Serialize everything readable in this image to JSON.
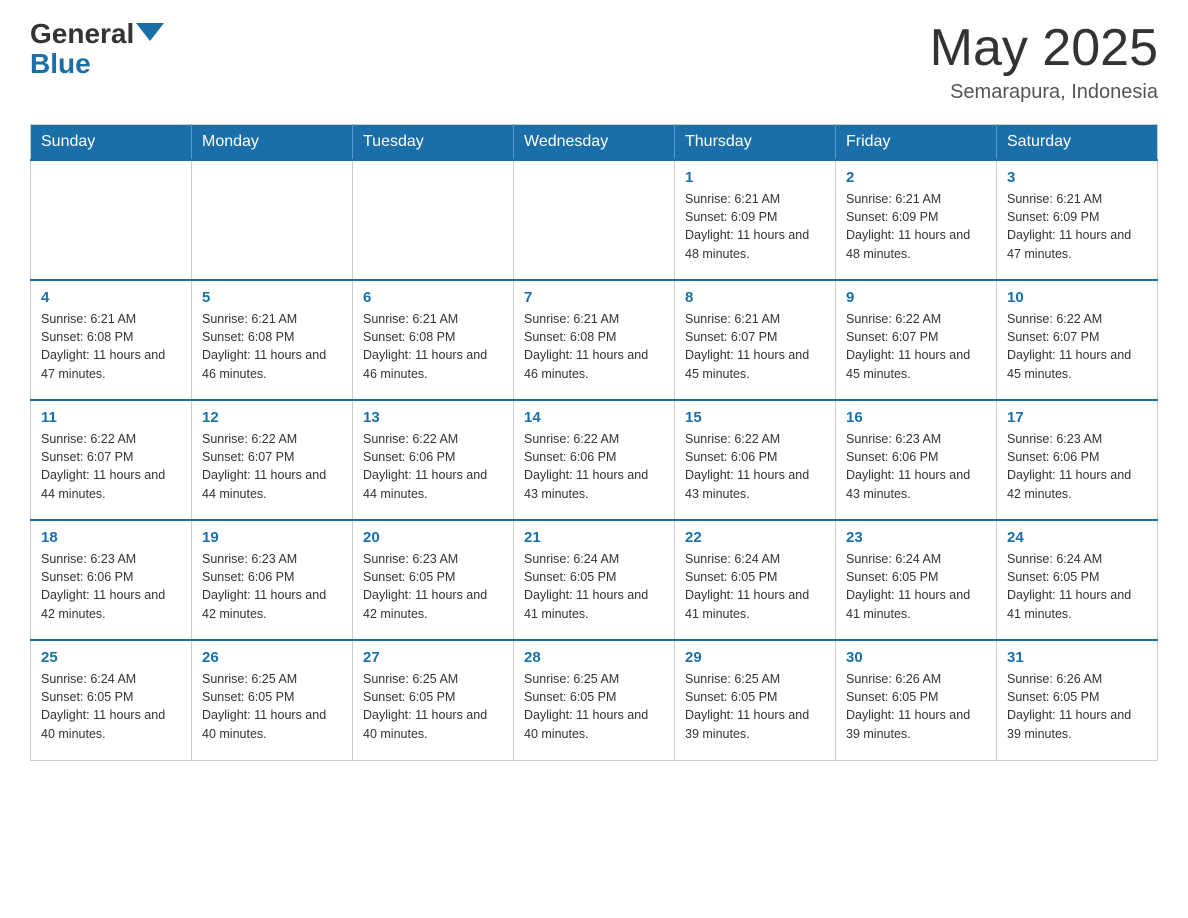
{
  "header": {
    "logo_text": "General",
    "logo_blue": "Blue",
    "month_title": "May 2025",
    "location": "Semarapura, Indonesia"
  },
  "weekdays": [
    "Sunday",
    "Monday",
    "Tuesday",
    "Wednesday",
    "Thursday",
    "Friday",
    "Saturday"
  ],
  "weeks": [
    [
      {
        "day": "",
        "info": ""
      },
      {
        "day": "",
        "info": ""
      },
      {
        "day": "",
        "info": ""
      },
      {
        "day": "",
        "info": ""
      },
      {
        "day": "1",
        "info": "Sunrise: 6:21 AM\nSunset: 6:09 PM\nDaylight: 11 hours and 48 minutes."
      },
      {
        "day": "2",
        "info": "Sunrise: 6:21 AM\nSunset: 6:09 PM\nDaylight: 11 hours and 48 minutes."
      },
      {
        "day": "3",
        "info": "Sunrise: 6:21 AM\nSunset: 6:09 PM\nDaylight: 11 hours and 47 minutes."
      }
    ],
    [
      {
        "day": "4",
        "info": "Sunrise: 6:21 AM\nSunset: 6:08 PM\nDaylight: 11 hours and 47 minutes."
      },
      {
        "day": "5",
        "info": "Sunrise: 6:21 AM\nSunset: 6:08 PM\nDaylight: 11 hours and 46 minutes."
      },
      {
        "day": "6",
        "info": "Sunrise: 6:21 AM\nSunset: 6:08 PM\nDaylight: 11 hours and 46 minutes."
      },
      {
        "day": "7",
        "info": "Sunrise: 6:21 AM\nSunset: 6:08 PM\nDaylight: 11 hours and 46 minutes."
      },
      {
        "day": "8",
        "info": "Sunrise: 6:21 AM\nSunset: 6:07 PM\nDaylight: 11 hours and 45 minutes."
      },
      {
        "day": "9",
        "info": "Sunrise: 6:22 AM\nSunset: 6:07 PM\nDaylight: 11 hours and 45 minutes."
      },
      {
        "day": "10",
        "info": "Sunrise: 6:22 AM\nSunset: 6:07 PM\nDaylight: 11 hours and 45 minutes."
      }
    ],
    [
      {
        "day": "11",
        "info": "Sunrise: 6:22 AM\nSunset: 6:07 PM\nDaylight: 11 hours and 44 minutes."
      },
      {
        "day": "12",
        "info": "Sunrise: 6:22 AM\nSunset: 6:07 PM\nDaylight: 11 hours and 44 minutes."
      },
      {
        "day": "13",
        "info": "Sunrise: 6:22 AM\nSunset: 6:06 PM\nDaylight: 11 hours and 44 minutes."
      },
      {
        "day": "14",
        "info": "Sunrise: 6:22 AM\nSunset: 6:06 PM\nDaylight: 11 hours and 43 minutes."
      },
      {
        "day": "15",
        "info": "Sunrise: 6:22 AM\nSunset: 6:06 PM\nDaylight: 11 hours and 43 minutes."
      },
      {
        "day": "16",
        "info": "Sunrise: 6:23 AM\nSunset: 6:06 PM\nDaylight: 11 hours and 43 minutes."
      },
      {
        "day": "17",
        "info": "Sunrise: 6:23 AM\nSunset: 6:06 PM\nDaylight: 11 hours and 42 minutes."
      }
    ],
    [
      {
        "day": "18",
        "info": "Sunrise: 6:23 AM\nSunset: 6:06 PM\nDaylight: 11 hours and 42 minutes."
      },
      {
        "day": "19",
        "info": "Sunrise: 6:23 AM\nSunset: 6:06 PM\nDaylight: 11 hours and 42 minutes."
      },
      {
        "day": "20",
        "info": "Sunrise: 6:23 AM\nSunset: 6:05 PM\nDaylight: 11 hours and 42 minutes."
      },
      {
        "day": "21",
        "info": "Sunrise: 6:24 AM\nSunset: 6:05 PM\nDaylight: 11 hours and 41 minutes."
      },
      {
        "day": "22",
        "info": "Sunrise: 6:24 AM\nSunset: 6:05 PM\nDaylight: 11 hours and 41 minutes."
      },
      {
        "day": "23",
        "info": "Sunrise: 6:24 AM\nSunset: 6:05 PM\nDaylight: 11 hours and 41 minutes."
      },
      {
        "day": "24",
        "info": "Sunrise: 6:24 AM\nSunset: 6:05 PM\nDaylight: 11 hours and 41 minutes."
      }
    ],
    [
      {
        "day": "25",
        "info": "Sunrise: 6:24 AM\nSunset: 6:05 PM\nDaylight: 11 hours and 40 minutes."
      },
      {
        "day": "26",
        "info": "Sunrise: 6:25 AM\nSunset: 6:05 PM\nDaylight: 11 hours and 40 minutes."
      },
      {
        "day": "27",
        "info": "Sunrise: 6:25 AM\nSunset: 6:05 PM\nDaylight: 11 hours and 40 minutes."
      },
      {
        "day": "28",
        "info": "Sunrise: 6:25 AM\nSunset: 6:05 PM\nDaylight: 11 hours and 40 minutes."
      },
      {
        "day": "29",
        "info": "Sunrise: 6:25 AM\nSunset: 6:05 PM\nDaylight: 11 hours and 39 minutes."
      },
      {
        "day": "30",
        "info": "Sunrise: 6:26 AM\nSunset: 6:05 PM\nDaylight: 11 hours and 39 minutes."
      },
      {
        "day": "31",
        "info": "Sunrise: 6:26 AM\nSunset: 6:05 PM\nDaylight: 11 hours and 39 minutes."
      }
    ]
  ]
}
